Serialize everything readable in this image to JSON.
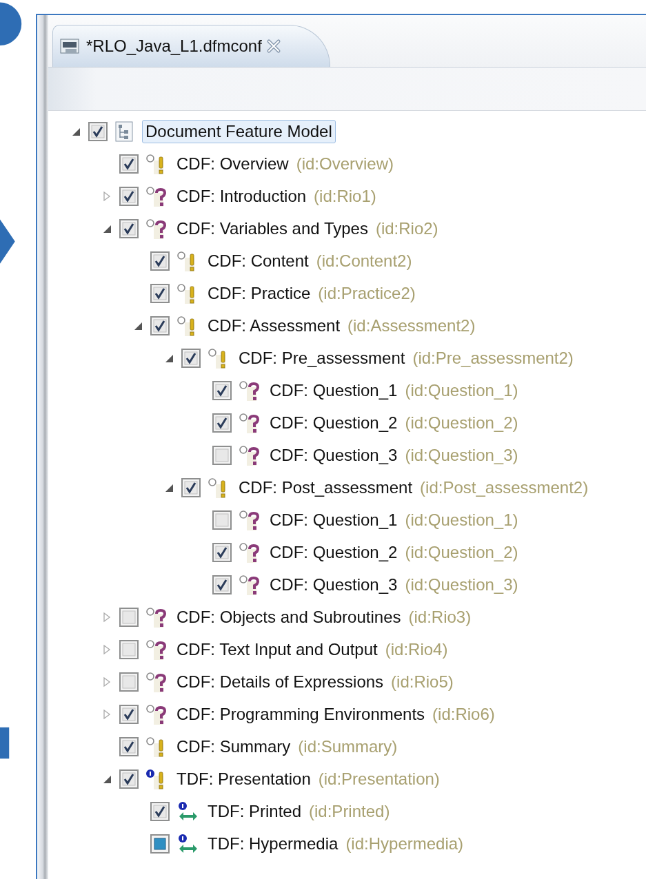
{
  "editor": {
    "tab": {
      "title": "*RLO_Java_L1.dfmconf"
    }
  },
  "tree": {
    "root": {
      "label": "Document Feature Model",
      "kind": "model",
      "checked": true,
      "partial": false,
      "expanded": true,
      "selected": true,
      "children": [
        {
          "label": "CDF: Overview",
          "id": "(id:Overview)",
          "kind": "mandatory",
          "checked": true,
          "partial": false,
          "selected": false
        },
        {
          "label": "CDF: Introduction",
          "id": "(id:Rio1)",
          "kind": "optional",
          "checked": true,
          "partial": false,
          "expanded": false,
          "selected": false
        },
        {
          "label": "CDF: Variables and Types",
          "id": "(id:Rio2)",
          "kind": "optional",
          "checked": true,
          "partial": false,
          "expanded": true,
          "selected": false,
          "children": [
            {
              "label": "CDF: Content",
              "id": "(id:Content2)",
              "kind": "mandatory",
              "checked": true,
              "partial": false,
              "selected": false
            },
            {
              "label": "CDF: Practice",
              "id": "(id:Practice2)",
              "kind": "mandatory",
              "checked": true,
              "partial": false,
              "selected": false
            },
            {
              "label": "CDF: Assessment",
              "id": "(id:Assessment2)",
              "kind": "mandatory",
              "checked": true,
              "partial": false,
              "expanded": true,
              "selected": false,
              "children": [
                {
                  "label": "CDF: Pre_assessment",
                  "id": "(id:Pre_assessment2)",
                  "kind": "mandatory",
                  "checked": true,
                  "partial": false,
                  "expanded": true,
                  "selected": false,
                  "children": [
                    {
                      "label": "CDF: Question_1",
                      "id": "(id:Question_1)",
                      "kind": "optional",
                      "checked": true,
                      "partial": false,
                      "selected": false
                    },
                    {
                      "label": "CDF: Question_2",
                      "id": "(id:Question_2)",
                      "kind": "optional",
                      "checked": true,
                      "partial": false,
                      "selected": false
                    },
                    {
                      "label": "CDF: Question_3",
                      "id": "(id:Question_3)",
                      "kind": "optional",
                      "checked": false,
                      "partial": false,
                      "selected": false
                    }
                  ]
                },
                {
                  "label": "CDF: Post_assessment",
                  "id": "(id:Post_assessment2)",
                  "kind": "mandatory",
                  "checked": true,
                  "partial": false,
                  "expanded": true,
                  "selected": false,
                  "children": [
                    {
                      "label": "CDF: Question_1",
                      "id": "(id:Question_1)",
                      "kind": "optional",
                      "checked": false,
                      "partial": false,
                      "selected": false
                    },
                    {
                      "label": "CDF: Question_2",
                      "id": "(id:Question_2)",
                      "kind": "optional",
                      "checked": true,
                      "partial": false,
                      "selected": false
                    },
                    {
                      "label": "CDF: Question_3",
                      "id": "(id:Question_3)",
                      "kind": "optional",
                      "checked": true,
                      "partial": false,
                      "selected": false
                    }
                  ]
                }
              ]
            }
          ]
        },
        {
          "label": "CDF: Objects and Subroutines",
          "id": "(id:Rio3)",
          "kind": "optional",
          "checked": false,
          "partial": false,
          "expanded": false,
          "selected": false
        },
        {
          "label": "CDF: Text Input and Output",
          "id": "(id:Rio4)",
          "kind": "optional",
          "checked": false,
          "partial": false,
          "expanded": false,
          "selected": false
        },
        {
          "label": "CDF: Details of Expressions",
          "id": "(id:Rio5)",
          "kind": "optional",
          "checked": false,
          "partial": false,
          "expanded": false,
          "selected": false
        },
        {
          "label": "CDF: Programming Environments",
          "id": "(id:Rio6)",
          "kind": "optional",
          "checked": true,
          "partial": false,
          "expanded": false,
          "selected": false
        },
        {
          "label": "CDF: Summary",
          "id": "(id:Summary)",
          "kind": "mandatory",
          "checked": true,
          "partial": false,
          "selected": false
        },
        {
          "label": "TDF: Presentation",
          "id": "(id:Presentation)",
          "kind": "technical",
          "checked": true,
          "partial": false,
          "expanded": true,
          "selected": false,
          "children": [
            {
              "label": "TDF: Printed",
              "id": "(id:Printed)",
              "kind": "alternative",
              "checked": true,
              "partial": false,
              "selected": false
            },
            {
              "label": "TDF: Hypermedia",
              "id": "(id:Hypermedia)",
              "kind": "alternative",
              "checked": false,
              "partial": true,
              "selected": false
            }
          ]
        }
      ]
    }
  }
}
